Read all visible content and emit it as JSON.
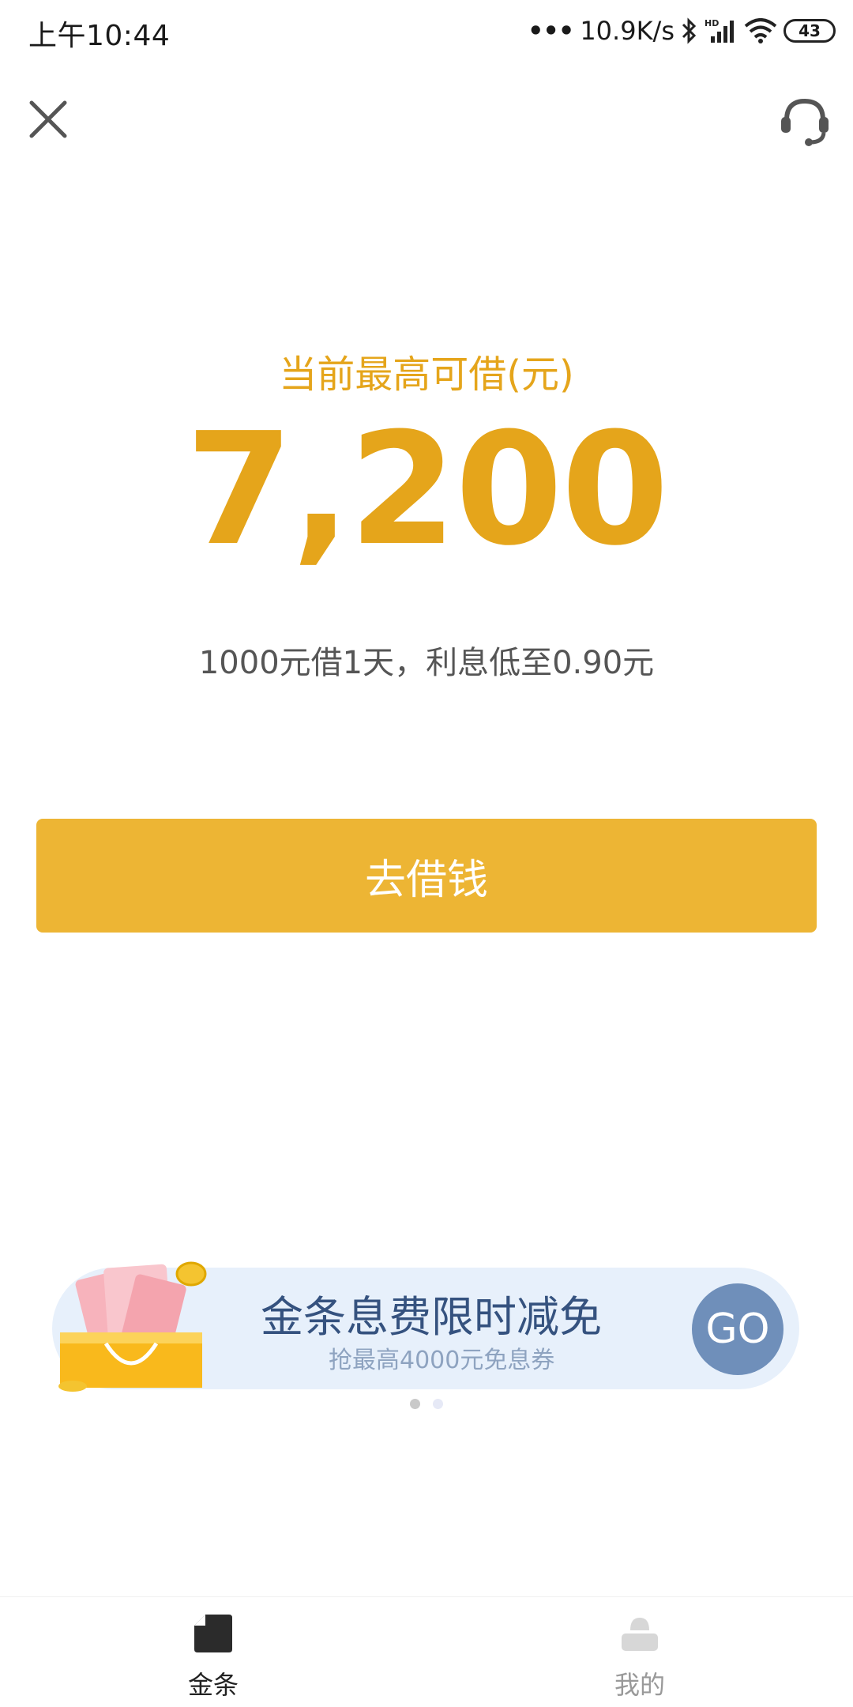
{
  "status_bar": {
    "time": "上午10:44",
    "network_speed": "10.9K/s",
    "battery_level": "43",
    "icons": [
      "more-dots-icon",
      "bluetooth-icon",
      "hd-signal-icon",
      "wifi-icon",
      "battery-icon"
    ]
  },
  "nav": {
    "close_icon": "close-icon",
    "support_icon": "customer-service-headset-icon"
  },
  "main": {
    "limit_label": "当前最高可借(元)",
    "limit_amount": "7,200",
    "interest_note": "1000元借1天，利息低至0.90元",
    "borrow_button": "去借钱"
  },
  "banner": {
    "title": "金条息费限时减免",
    "subtitle": "抢最高4000元免息券",
    "go_label": "GO",
    "page_count": 2,
    "active_page": 1
  },
  "tabs": [
    {
      "label": "金条",
      "icon": "jintiao-icon",
      "active": true
    },
    {
      "label": "我的",
      "icon": "profile-icon",
      "active": false
    }
  ],
  "colors": {
    "accent": "#e5a51b",
    "button": "#edb534",
    "banner_bg": "#e7f0fb",
    "banner_title": "#35527f",
    "go_button": "#6f8fba"
  }
}
